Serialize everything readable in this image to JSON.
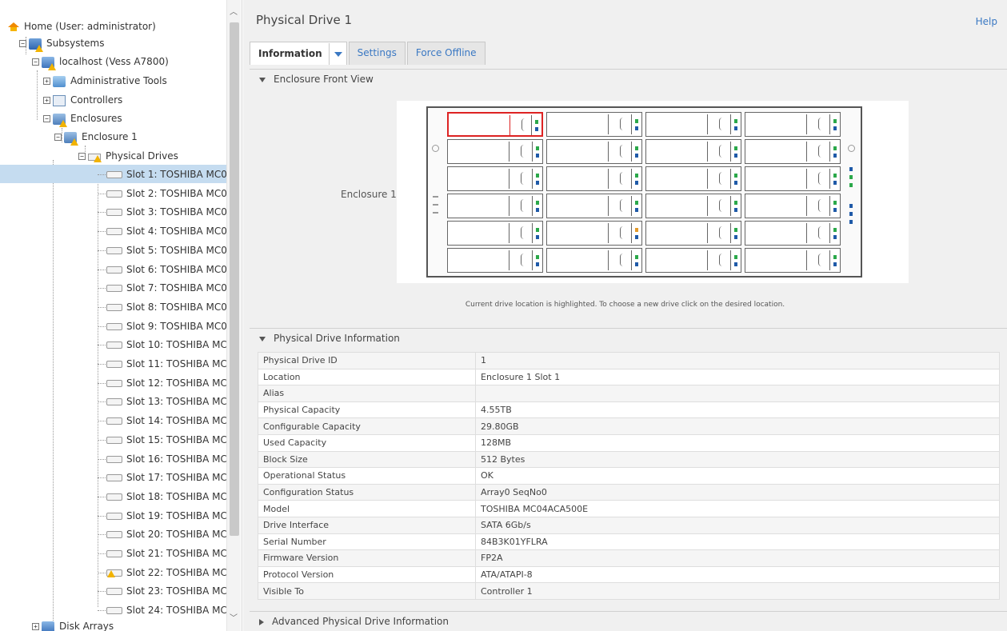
{
  "tree": {
    "home": "Home (User: administrator)",
    "subsystems": "Subsystems",
    "host": "localhost (Vess A7800)",
    "admin_tools": "Administrative Tools",
    "controllers": "Controllers",
    "enclosures": "Enclosures",
    "enclosure1": "Enclosure 1",
    "physical_drives": "Physical Drives",
    "slots": [
      "Slot 1: TOSHIBA MC0",
      "Slot 2: TOSHIBA MC0",
      "Slot 3: TOSHIBA MC0",
      "Slot 4: TOSHIBA MC0",
      "Slot 5: TOSHIBA MC0",
      "Slot 6: TOSHIBA MC0",
      "Slot 7: TOSHIBA MC0",
      "Slot 8: TOSHIBA MC0",
      "Slot 9: TOSHIBA MC0",
      "Slot 10: TOSHIBA MC",
      "Slot 11: TOSHIBA MC",
      "Slot 12: TOSHIBA MC",
      "Slot 13: TOSHIBA MC",
      "Slot 14: TOSHIBA MC",
      "Slot 15: TOSHIBA MC",
      "Slot 16: TOSHIBA MC",
      "Slot 17: TOSHIBA MC",
      "Slot 18: TOSHIBA MC",
      "Slot 19: TOSHIBA MC",
      "Slot 20: TOSHIBA MC",
      "Slot 21: TOSHIBA MC",
      "Slot 22: TOSHIBA MC",
      "Slot 23: TOSHIBA MC",
      "Slot 24: TOSHIBA MC"
    ],
    "selected_slot": 1,
    "warning_slot": 22,
    "disk_arrays": "Disk Arrays"
  },
  "header": {
    "title": "Physical Drive 1",
    "help": "Help"
  },
  "tabs": [
    "Information",
    "Settings",
    "Force Offline"
  ],
  "enclosure_view": {
    "section_title": "Enclosure Front View",
    "label": "Enclosure 1",
    "note": "Current drive location is highlighted. To choose a new drive click on the desired location.",
    "highlight_color": "#d22222",
    "amber_bay": 18
  },
  "drive_info": {
    "section_title": "Physical Drive Information",
    "rows": [
      [
        "Physical Drive ID",
        "1"
      ],
      [
        "Location",
        "Enclosure 1 Slot 1"
      ],
      [
        "Alias",
        ""
      ],
      [
        "Physical Capacity",
        "4.55TB"
      ],
      [
        "Configurable Capacity",
        "29.80GB"
      ],
      [
        "Used Capacity",
        "128MB"
      ],
      [
        "Block Size",
        "512 Bytes"
      ],
      [
        "Operational Status",
        "OK"
      ],
      [
        "Configuration Status",
        "Array0 SeqNo0"
      ],
      [
        "Model",
        "TOSHIBA MC04ACA500E"
      ],
      [
        "Drive Interface",
        "SATA 6Gb/s"
      ],
      [
        "Serial Number",
        "84B3K01YFLRA"
      ],
      [
        "Firmware Version",
        "FP2A"
      ],
      [
        "Protocol Version",
        "ATA/ATAPI-8"
      ],
      [
        "Visible To",
        "Controller 1"
      ]
    ]
  },
  "advanced": {
    "section_title": "Advanced Physical Drive Information"
  },
  "colors": {
    "link": "#3a78c3",
    "selection": "#c5dcf0",
    "warning": "#f2b300"
  }
}
